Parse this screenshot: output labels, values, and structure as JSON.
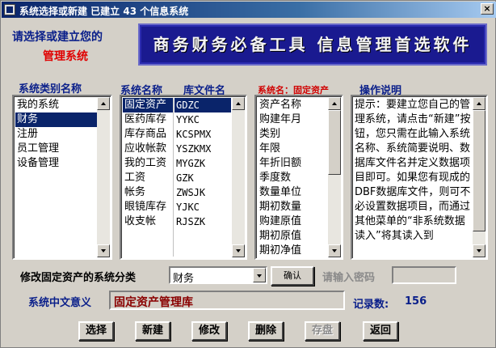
{
  "window": {
    "title": "系统选择或新建  已建立 43 个信息系统",
    "close_glyph": "×"
  },
  "prompt": {
    "line1": "请选择或建立您的",
    "line2": "管理系统"
  },
  "banner": {
    "text": "商务财务必备工具  信息管理首选软件"
  },
  "headers": {
    "category": "系统类别名称",
    "system_name": "系统名称",
    "db_file": "库文件名",
    "current_system": "系统名：固定资产",
    "instructions": "操作说明"
  },
  "categories": {
    "items": [
      "我的系统",
      "财务",
      "注册",
      "员工管理",
      "设备管理"
    ],
    "selected_index": 1
  },
  "systems": {
    "names": [
      "固定资产",
      "医药库存",
      "库存商品",
      "应收帐款",
      "我的工资",
      "工资",
      "帐务",
      "眼镜库存",
      "收支帐"
    ],
    "files": [
      "GDZC",
      "YYKC",
      "KCSPMX",
      "YSZKMX",
      "MYGZK",
      "GZK",
      "ZWSJK",
      "YJKC",
      "RJSZK"
    ],
    "selected_index": 0
  },
  "fields": {
    "items": [
      "资产名称",
      "购建年月",
      "类别",
      "年限",
      "年折旧额",
      "季度数",
      "数量单位",
      "期初数量",
      "购建原值",
      "期初原值",
      "期初净值"
    ]
  },
  "instructions": {
    "text": "提示：要建立您自己的管理系统，请点击“新建”按钮，您只需在此输入系统名称、系统简要说明、数据库文件名并定义数据项目即可。如果您有现成的DBF数据库文件，则可不必设置数据项目，而通过其他菜单的“非系统数据读入”将其读入到"
  },
  "classify": {
    "label": "修改固定资产的系统分类",
    "value": "财务",
    "confirm_label": "确认",
    "password_label": "请输入密码",
    "password_value": ""
  },
  "meaning": {
    "label": "系统中文意义",
    "value": "固定资产管理库"
  },
  "records": {
    "label": "记录数:",
    "count": "156"
  },
  "buttons": {
    "select": "选择",
    "new": "新建",
    "modify": "修改",
    "delete": "删除",
    "save": "存盘",
    "back": "返回"
  }
}
